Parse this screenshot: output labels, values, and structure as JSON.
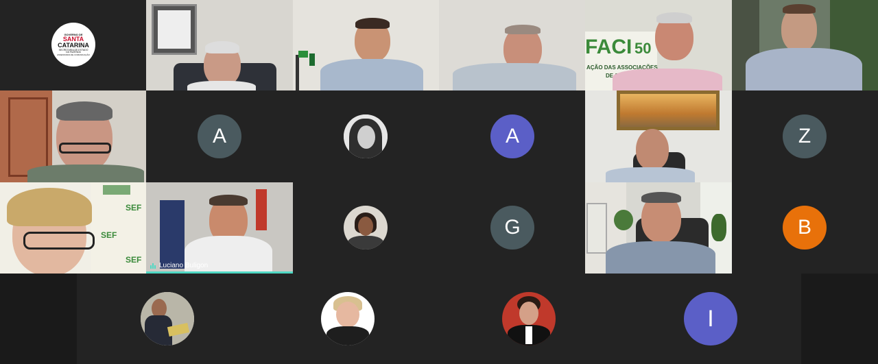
{
  "meeting": {
    "logo": {
      "line1": "GOVERNO DE",
      "line2": "SANTA",
      "line3": "CATARINA",
      "line4": "SECRETARIA DE ESTADO",
      "line5": "DA FAZENDA",
      "line6": "ASSESSORIA DE COMUNICAÇÃO"
    },
    "avatars": {
      "a1": "A",
      "a2": "A",
      "z": "Z",
      "g": "G",
      "b": "B",
      "i": "I"
    },
    "colors": {
      "grey_avatar": "#4a5a5f",
      "purple_avatar": "#5b5fc7",
      "orange_avatar": "#e8710a",
      "active_speaker": "#4fd8c4"
    },
    "video_texts": {
      "faci_banner": "FACI",
      "faci_number": "50",
      "faci_subtitle": "AÇÃO DAS ASSOCIAÇÕES",
      "faci_subtitle2": "DE SANTA CATARINA",
      "sef": "SEF"
    },
    "active_speaker": {
      "name": "Luciano Buligon",
      "icon": "audio-level-icon"
    }
  }
}
